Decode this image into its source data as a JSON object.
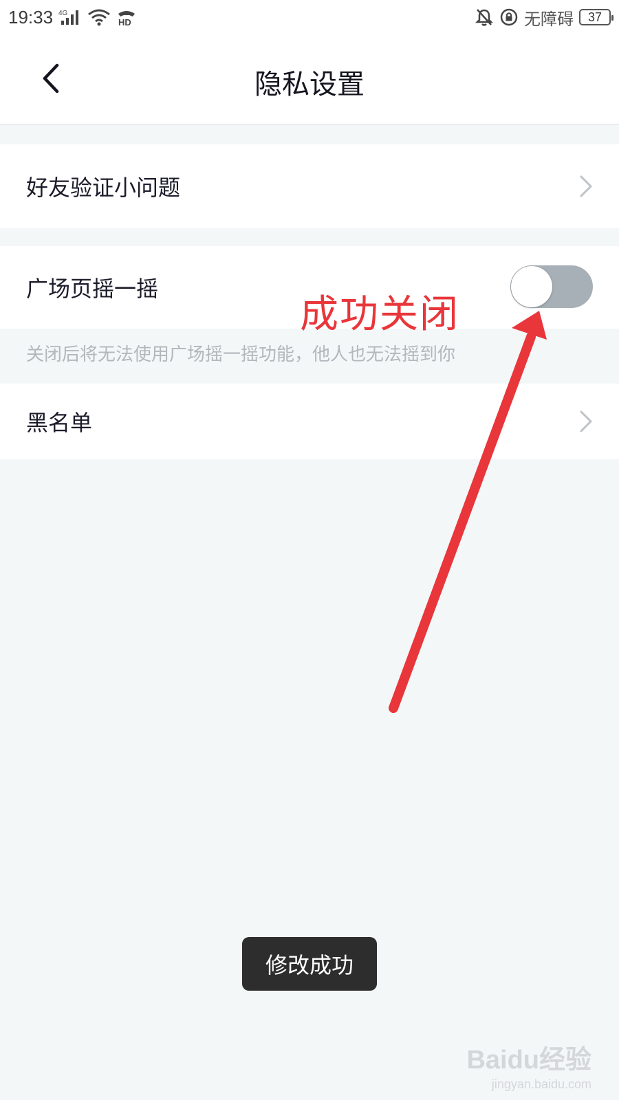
{
  "status_bar": {
    "time": "19:33",
    "accessibility": "无障碍",
    "battery": "37",
    "icons": [
      "signal-4g-icon",
      "wifi-icon",
      "hd-call-icon",
      "bell-off-icon",
      "lock-rotation-icon"
    ]
  },
  "header": {
    "title": "隐私设置",
    "back_icon": "chevron-left-icon"
  },
  "settings": {
    "friend_question": "好友验证小问题",
    "plaza_shake": "广场页摇一摇",
    "plaza_shake_enabled": false,
    "plaza_shake_hint": "关闭后将无法使用广场摇一摇功能，他人也无法摇到你",
    "blacklist": "黑名单"
  },
  "annotation": {
    "text": "成功关闭",
    "color": "#e8363a"
  },
  "toast": {
    "message": "修改成功"
  },
  "watermark": {
    "logo": "Baidu经验",
    "url": "jingyan.baidu.com"
  },
  "colors": {
    "background": "#f4f7f8",
    "toggle_off": "#a7b0b7",
    "annotation_red": "#e8363a"
  }
}
